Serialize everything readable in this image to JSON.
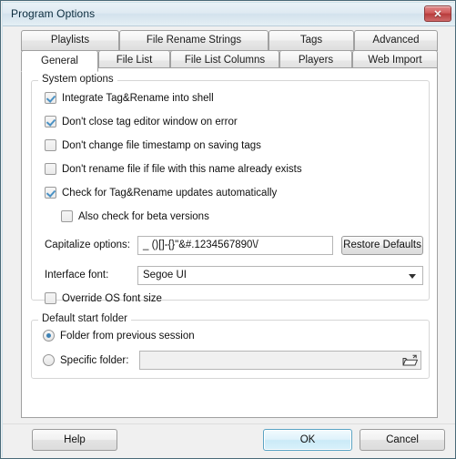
{
  "window": {
    "title": "Program Options",
    "close_label": "✕",
    "close_icon": "close-icon",
    "accent_color": "#4a6a78",
    "titlebar_color": "#dfeaf2",
    "close_button_color": "#c24a4a"
  },
  "tabs": {
    "row_top": [
      {
        "label": "Playlists",
        "selected": false
      },
      {
        "label": "File Rename Strings",
        "selected": false
      },
      {
        "label": "Tags",
        "selected": false
      },
      {
        "label": "Advanced",
        "selected": false
      }
    ],
    "row_bottom": [
      {
        "label": "General",
        "selected": true
      },
      {
        "label": "File List",
        "selected": false
      },
      {
        "label": "File List Columns",
        "selected": false
      },
      {
        "label": "Players",
        "selected": false
      },
      {
        "label": "Web Import",
        "selected": false
      }
    ]
  },
  "system_options": {
    "group_title": "System options",
    "checkboxes": [
      {
        "label": "Integrate Tag&Rename into shell",
        "checked": true
      },
      {
        "label": "Don't close tag editor window on error",
        "checked": true
      },
      {
        "label": "Don't change file timestamp on saving tags",
        "checked": false
      },
      {
        "label": "Don't rename file if file with this name already exists",
        "checked": false
      },
      {
        "label": "Check for Tag&Rename updates automatically",
        "checked": true
      },
      {
        "label": "Also check for beta versions",
        "checked": false
      }
    ],
    "capitalize": {
      "label": "Capitalize options:",
      "value": "_ ()[]-{}\"&#.1234567890\\/",
      "placeholder": ""
    },
    "restore_defaults_label": "Restore Defaults",
    "interface_font": {
      "label": "Interface font:",
      "value": "Segoe UI",
      "arrow_icon": "chevron-down-icon"
    },
    "override_font_size": {
      "label": "Override OS font size",
      "checked": false
    }
  },
  "default_start_folder": {
    "group_title": "Default start folder",
    "radios": [
      {
        "label": "Folder from previous session",
        "checked": true
      },
      {
        "label": "Specific folder:",
        "checked": false
      }
    ],
    "specific_folder_value": "",
    "specific_folder_placeholder": "",
    "browse_icon": "folder-open-icon"
  },
  "footer": {
    "help_label": "Help",
    "ok_label": "OK",
    "cancel_label": "Cancel"
  }
}
